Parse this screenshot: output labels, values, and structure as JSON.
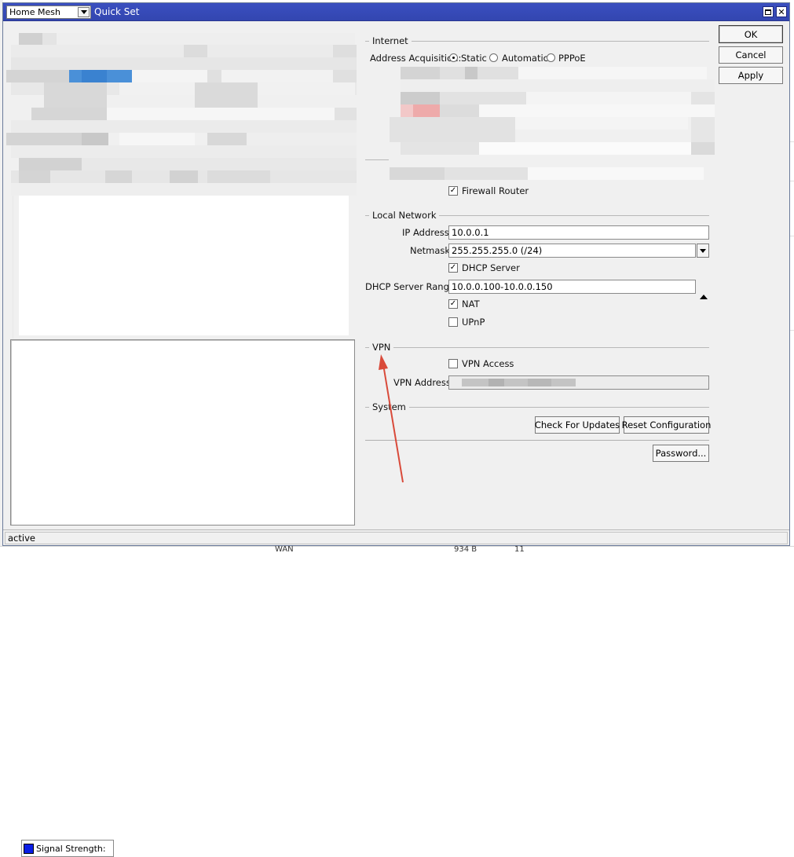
{
  "window": {
    "mode_select": "Home Mesh",
    "title": "Quick Set"
  },
  "internet": {
    "group_title": "Internet",
    "address_acquisition_label": "Address Acquisition:",
    "options": [
      "Static",
      "Automatic",
      "PPPoE"
    ],
    "selected": "Static",
    "firewall_router_label": "Firewall Router",
    "firewall_router_checked": true
  },
  "local_network": {
    "group_title": "Local Network",
    "ip_address_label": "IP Address:",
    "ip_address": "10.0.0.1",
    "netmask_label": "Netmask:",
    "netmask": "255.255.255.0 (/24)",
    "dhcp_server_label": "DHCP Server",
    "dhcp_server_checked": true,
    "dhcp_range_label": "DHCP Server Range:",
    "dhcp_range": "10.0.0.100-10.0.0.150",
    "nat_label": "NAT",
    "nat_checked": true,
    "upnp_label": "UPnP",
    "upnp_checked": false
  },
  "vpn": {
    "group_title": "VPN",
    "vpn_access_label": "VPN Access",
    "vpn_access_checked": false,
    "vpn_address_label": "VPN Address:"
  },
  "system": {
    "group_title": "System",
    "check_updates": "Check For Updates",
    "reset_config": "Reset Configuration",
    "password": "Password..."
  },
  "actions": {
    "ok": "OK",
    "cancel": "Cancel",
    "apply": "Apply"
  },
  "signal_legend": "Signal Strength:",
  "status": "active",
  "background": {
    "bottom_text_1": "WAN",
    "bottom_text_2": "934 B",
    "bottom_text_3": "11"
  },
  "colors": {
    "titlebar": "#3a4fc0",
    "signal_swatch": "#0a1ee6",
    "annotation_arrow": "#d94a3a"
  }
}
